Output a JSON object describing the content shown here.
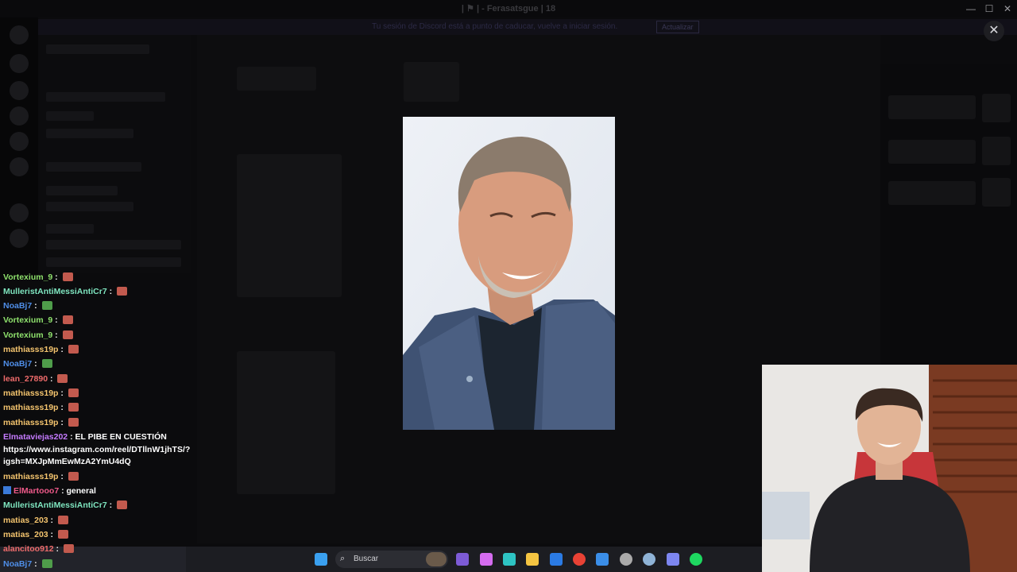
{
  "window": {
    "title": "| ⚑ | - Ferasatsgue | 18",
    "controls": [
      "—",
      "☐",
      "✕"
    ]
  },
  "banner": {
    "text": "Tu sesión de Discord está a punto de caducar, vuelve a iniciar sesión.",
    "button": "Actualizar"
  },
  "server": {
    "name": "| ⚑ | - Ferasatsg...",
    "channel_header": "| ⚑ | WEBES LA GRASA"
  },
  "channels": {
    "items": [
      "WEBES LA GRASA",
      "rules",
      "anuncios",
      "general",
      "clips"
    ]
  },
  "viewer": {
    "close_icon": "close-icon"
  },
  "chat": {
    "messages": [
      {
        "user": "Vortexium_9",
        "color": "#8fe26d",
        "emote": "red",
        "text": ""
      },
      {
        "user": "MulleristAntiMessiAntiCr7",
        "color": "#7fe6c0",
        "emote": "red",
        "text": ""
      },
      {
        "user": "NoaBj7",
        "color": "#4f8ee8",
        "emote": "green",
        "text": ""
      },
      {
        "user": "Vortexium_9",
        "color": "#8fe26d",
        "emote": "red",
        "text": ""
      },
      {
        "user": "Vortexium_9",
        "color": "#8fe26d",
        "emote": "red",
        "text": ""
      },
      {
        "user": "mathiasss19p",
        "color": "#f4c46e",
        "emote": "red",
        "text": ""
      },
      {
        "user": "NoaBj7",
        "color": "#4f8ee8",
        "emote": "green",
        "text": ""
      },
      {
        "user": "lean_27890",
        "color": "#ef6b6b",
        "emote": "red",
        "text": ""
      },
      {
        "user": "mathiasss19p",
        "color": "#f4c46e",
        "emote": "red",
        "text": ""
      },
      {
        "user": "mathiasss19p",
        "color": "#f4c46e",
        "emote": "red",
        "text": ""
      },
      {
        "user": "mathiasss19p",
        "color": "#f4c46e",
        "emote": "red",
        "text": ""
      },
      {
        "user": "Elmataviejas202",
        "color": "#c57bff",
        "emote": "",
        "text": "EL PIBE EN CUESTIÓN"
      },
      {
        "user": "",
        "color": "#ffffff",
        "emote": "",
        "text": "https://www.instagram.com/reel/DTllnW1jhTS/?"
      },
      {
        "user": "",
        "color": "#ffffff",
        "emote": "",
        "text": "igsh=MXJpMmEwMzA2YmU4dQ"
      },
      {
        "user": "mathiasss19p",
        "color": "#f4c46e",
        "emote": "red",
        "text": ""
      },
      {
        "user": "ElMartooo7",
        "color": "#ef5a8a",
        "emote": "",
        "text": "general",
        "badge": true
      },
      {
        "user": "MulleristAntiMessiAntiCr7",
        "color": "#7fe6c0",
        "emote": "red",
        "text": ""
      },
      {
        "user": "matias_203",
        "color": "#f4c46e",
        "emote": "red",
        "text": ""
      },
      {
        "user": "matias_203",
        "color": "#f4c46e",
        "emote": "red",
        "text": ""
      },
      {
        "user": "alancitoo912",
        "color": "#ef6b6b",
        "emote": "red",
        "text": ""
      },
      {
        "user": "NoaBj7",
        "color": "#4f8ee8",
        "emote": "green",
        "text": ""
      }
    ]
  },
  "taskbar": {
    "search_placeholder": "Buscar",
    "apps": [
      {
        "name": "windows-start-icon",
        "color": "#3aa0f0"
      },
      {
        "name": "file-explorer-icon",
        "color": "#f3c033"
      },
      {
        "name": "copilot-icon",
        "color": "#d56cf0"
      },
      {
        "name": "edge-icon",
        "color": "#2ec4c4"
      },
      {
        "name": "folder-icon",
        "color": "#f5c542"
      },
      {
        "name": "store-icon",
        "color": "#2b7be4"
      },
      {
        "name": "chrome-icon",
        "color": "#e94235"
      },
      {
        "name": "outlook-icon",
        "color": "#3b8ee8"
      },
      {
        "name": "obs-icon",
        "color": "#aaaaaa"
      },
      {
        "name": "steam-icon",
        "color": "#8fb3d6"
      },
      {
        "name": "discord-icon",
        "color": "#7d86f0"
      },
      {
        "name": "spotify-icon",
        "color": "#1ed760"
      }
    ]
  }
}
